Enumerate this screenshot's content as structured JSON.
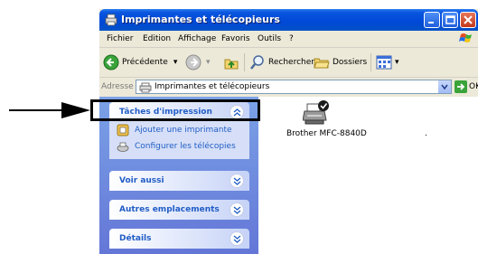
{
  "window": {
    "title": "Imprimantes et télécopieurs"
  },
  "menu": [
    "Fichier",
    "Edition",
    "Affichage",
    "Favoris",
    "Outils",
    "?"
  ],
  "toolbar": {
    "back_label": "Précédente",
    "search_label": "Rechercher",
    "folders_label": "Dossiers"
  },
  "address": {
    "label": "Adresse",
    "value": "Imprimantes et télécopieurs",
    "go_label": "OK"
  },
  "taskpane": {
    "print_tasks": {
      "title": "Tâches d'impression",
      "items": [
        "Ajouter une imprimante",
        "Configurer les télécopies"
      ]
    },
    "see_also": {
      "title": "Voir aussi"
    },
    "other_places": {
      "title": "Autres emplacements"
    },
    "details": {
      "title": "Détails"
    }
  },
  "printer": {
    "name": "Brother MFC-8840D",
    "extra": "."
  },
  "icons": {
    "window": "printer-folder-icon",
    "back": "back-arrow-icon",
    "forward": "forward-arrow-icon",
    "up": "folder-up-icon",
    "search": "search-icon",
    "folders": "folders-icon",
    "views": "views-icon",
    "go": "go-arrow-icon",
    "printer": "printer-icon",
    "add_printer": "add-printer-icon",
    "fax": "fax-icon"
  }
}
